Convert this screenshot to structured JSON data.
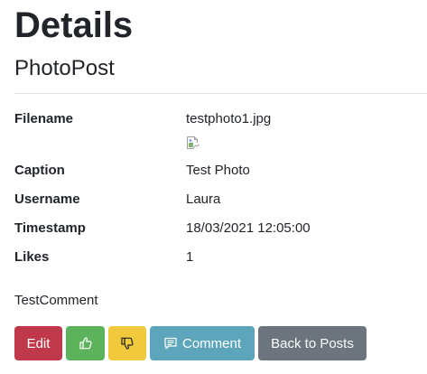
{
  "header": {
    "title": "Details",
    "subtitle": "PhotoPost"
  },
  "details": {
    "filename_label": "Filename",
    "filename_value": "testphoto1.jpg",
    "caption_label": "Caption",
    "caption_value": "Test Photo",
    "username_label": "Username",
    "username_value": "Laura",
    "timestamp_label": "Timestamp",
    "timestamp_value": "18/03/2021 12:05:00",
    "likes_label": "Likes",
    "likes_value": "1"
  },
  "image": {
    "icon": "broken-image-icon"
  },
  "comments": {
    "text": "TestComment"
  },
  "actions": {
    "edit_label": "Edit",
    "like_icon": "thumbs-up-icon",
    "dislike_icon": "thumbs-down-icon",
    "comment_icon": "chat-bubble-icon",
    "comment_label": "Comment",
    "back_label": "Back to Posts"
  },
  "colors": {
    "edit": "#c0394b",
    "like": "#5cb35b",
    "dislike": "#f0c93c",
    "comment": "#5ca5ba",
    "back": "#6c757d"
  }
}
